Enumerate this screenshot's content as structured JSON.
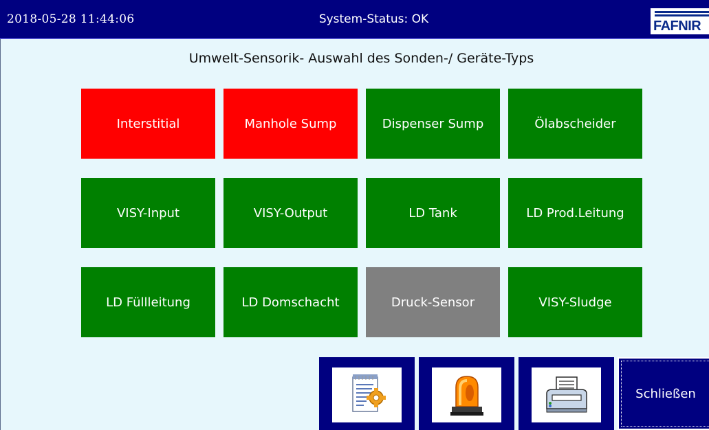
{
  "header": {
    "datetime": "2018-05-28  11:44:06",
    "status": "System-Status: OK",
    "logo_text": "FAFNIR"
  },
  "subtitle": "Umwelt-Sensorik- Auswahl des Sonden-/ Geräte-Typs",
  "tiles": [
    {
      "label": "Interstitial",
      "color": "#ff0000"
    },
    {
      "label": "Manhole Sump",
      "color": "#ff0000"
    },
    {
      "label": "Dispenser Sump",
      "color": "#008000"
    },
    {
      "label": "Ölabscheider",
      "color": "#008000"
    },
    {
      "label": "VISY-Input",
      "color": "#008000"
    },
    {
      "label": "VISY-Output",
      "color": "#008000"
    },
    {
      "label": "LD Tank",
      "color": "#008000"
    },
    {
      "label": "LD Prod.Leitung",
      "color": "#008000"
    },
    {
      "label": "LD Füllleitung",
      "color": "#008000"
    },
    {
      "label": "LD Domschacht",
      "color": "#008000"
    },
    {
      "label": "Druck-Sensor",
      "color": "#808080"
    },
    {
      "label": "VISY-Sludge",
      "color": "#008000"
    }
  ],
  "toolbar": {
    "icons": [
      "notepad-icon",
      "alarm-beacon-icon",
      "printer-icon"
    ],
    "close_label": "Schließen"
  },
  "colors": {
    "header_bg": "#000080",
    "page_bg": "#e7f7fc",
    "alarm": "#ff0000",
    "ok": "#008000",
    "inactive": "#808080"
  }
}
